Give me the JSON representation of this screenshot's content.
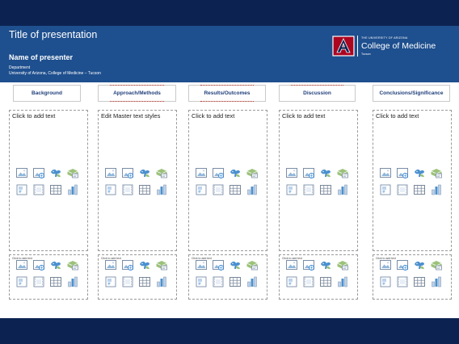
{
  "header": {
    "title": "Title of presentation",
    "presenter": "Name of presenter",
    "department": "Department",
    "university": "University of Arizona, College of Medicine – Tucson"
  },
  "logo": {
    "small": "THE UNIVERSITY OF ARIZONA",
    "big": "College of Medicine",
    "campus": "Tucson",
    "brand_red": "#ab0520"
  },
  "columns": [
    {
      "heading": "Background",
      "main_placeholder": "Click to add text",
      "small_placeholder": "Click to add text"
    },
    {
      "heading": "Approach/Methods",
      "main_placeholder": "Edit Master text styles",
      "small_placeholder": "Click to add text"
    },
    {
      "heading": "Results/Outcomes",
      "main_placeholder": "Click to add text",
      "small_placeholder": "Click to add text"
    },
    {
      "heading": "Discussion",
      "main_placeholder": "Click to add text",
      "small_placeholder": "Click to add text"
    },
    {
      "heading": "Conclusions/Significance",
      "main_placeholder": "Click to add text",
      "small_placeholder": "Click to add text"
    }
  ],
  "insert_icons": [
    "insert-picture-icon",
    "online-picture-icon",
    "insert-icons-icon",
    "insert-3d-model-icon",
    "smartart-icon",
    "insert-video-icon",
    "insert-table-icon",
    "insert-chart-icon"
  ],
  "colors": {
    "header_bg": "#1e4f8e",
    "frame_bg": "#0c2352",
    "heading_text": "#1f3e7a",
    "placeholder_border": "#9a9a9a"
  }
}
